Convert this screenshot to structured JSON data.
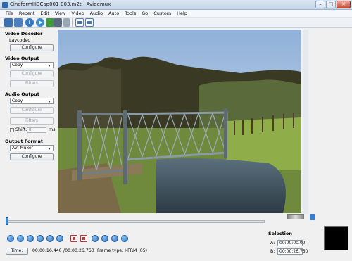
{
  "window": {
    "title": "CineformHDCap001-003.m2t - Avidemux",
    "min_glyph": "–",
    "max_glyph": "□",
    "close_glyph": "✕"
  },
  "menu": [
    "File",
    "Recent",
    "Edit",
    "View",
    "Video",
    "Audio",
    "Auto",
    "Tools",
    "Go",
    "Custom",
    "Help"
  ],
  "toolbar": {
    "info_glyph": "i"
  },
  "sidebar": {
    "video_decoder": {
      "title": "Video Decoder",
      "codec": "Lavcodec",
      "configure": "Configure"
    },
    "video_output": {
      "title": "Video Output",
      "codec": "Copy",
      "configure": "Configure",
      "filters": "Filters"
    },
    "audio_output": {
      "title": "Audio Output",
      "codec": "Copy",
      "configure": "Configure",
      "filters": "Filters",
      "shift_label": "Shift:",
      "shift_value": "0",
      "shift_unit": "ms"
    },
    "output_format": {
      "title": "Output Format",
      "muxer": "AVI Muxer",
      "configure": "Configure"
    }
  },
  "status": {
    "time_button": "Time:",
    "current_time": "00:00:16.440",
    "total_time": "/00:00:26.760",
    "frame_type": "Frame type: I-FRM (05)"
  },
  "selection": {
    "title": "Selection",
    "a_label": "A:",
    "a_value": "00:00:00.00",
    "b_label": "B:",
    "b_value": "00:00:26.760"
  },
  "playback": {
    "progress_fraction": 0.0
  },
  "colors": {
    "accent": "#2a6fbf",
    "title_bar": "#c3d4e8"
  }
}
